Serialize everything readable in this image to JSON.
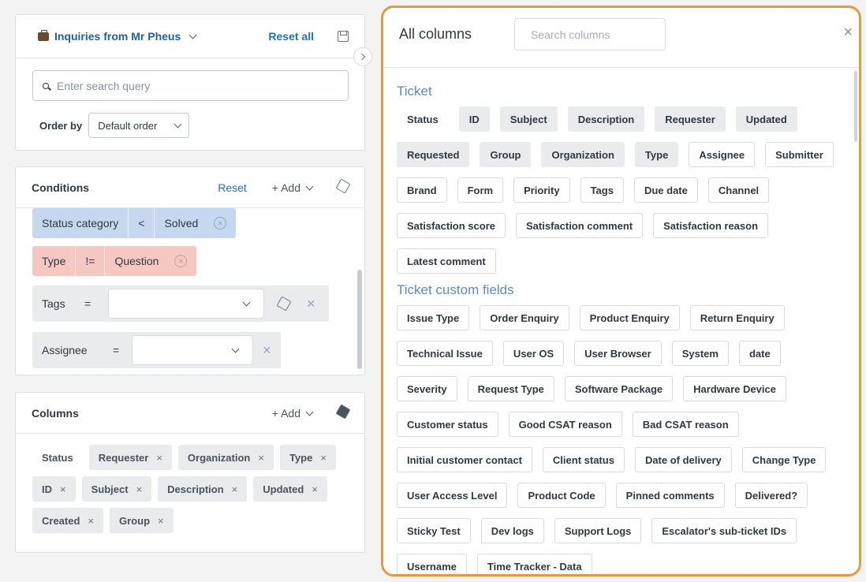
{
  "view": {
    "title": "Inquiries from Mr Pheus",
    "reset_all": "Reset all",
    "search_placeholder": "Enter search query",
    "order_label": "Order by",
    "order_value": "Default order"
  },
  "conditions": {
    "title": "Conditions",
    "reset": "Reset",
    "add": "+ Add",
    "rows": [
      {
        "field": "Status category",
        "op": "<",
        "value": "Solved"
      },
      {
        "field": "Type",
        "op": "!=",
        "value": "Question"
      },
      {
        "field": "Tags",
        "op": "="
      },
      {
        "field": "Assignee",
        "op": "="
      }
    ]
  },
  "columns": {
    "title": "Columns",
    "add": "+ Add",
    "items": [
      "Status",
      "Requester",
      "Organization",
      "Type",
      "ID",
      "Subject",
      "Description",
      "Updated",
      "Created",
      "Group"
    ]
  },
  "dialog": {
    "title": "All columns",
    "search_placeholder": "Search columns",
    "close": "×",
    "sections": [
      {
        "title": "Ticket",
        "chips": [
          {
            "label": "Status",
            "state": "plain"
          },
          {
            "label": "ID",
            "state": "selected"
          },
          {
            "label": "Subject",
            "state": "selected"
          },
          {
            "label": "Description",
            "state": "selected"
          },
          {
            "label": "Requester",
            "state": "selected"
          },
          {
            "label": "Updated",
            "state": "selected"
          },
          {
            "label": "Requested",
            "state": "selected"
          },
          {
            "label": "Group",
            "state": "selected"
          },
          {
            "label": "Organization",
            "state": "selected"
          },
          {
            "label": "Type",
            "state": "selected"
          },
          {
            "label": "Assignee",
            "state": "available"
          },
          {
            "label": "Submitter",
            "state": "available"
          },
          {
            "label": "Brand",
            "state": "available"
          },
          {
            "label": "Form",
            "state": "available"
          },
          {
            "label": "Priority",
            "state": "available"
          },
          {
            "label": "Tags",
            "state": "available"
          },
          {
            "label": "Due date",
            "state": "available"
          },
          {
            "label": "Channel",
            "state": "available"
          },
          {
            "label": "Satisfaction score",
            "state": "available"
          },
          {
            "label": "Satisfaction comment",
            "state": "available"
          },
          {
            "label": "Satisfaction reason",
            "state": "available"
          },
          {
            "label": "Latest comment",
            "state": "available"
          }
        ]
      },
      {
        "title": "Ticket custom fields",
        "chips": [
          {
            "label": "Issue Type",
            "state": "available"
          },
          {
            "label": "Order Enquiry",
            "state": "available"
          },
          {
            "label": "Product Enquiry",
            "state": "available"
          },
          {
            "label": "Return Enquiry",
            "state": "available"
          },
          {
            "label": "Technical Issue",
            "state": "available"
          },
          {
            "label": "User OS",
            "state": "available"
          },
          {
            "label": "User Browser",
            "state": "available"
          },
          {
            "label": "System",
            "state": "available"
          },
          {
            "label": "date",
            "state": "available"
          },
          {
            "label": "Severity",
            "state": "available"
          },
          {
            "label": "Request Type",
            "state": "available"
          },
          {
            "label": "Software Package",
            "state": "available"
          },
          {
            "label": "Hardware Device",
            "state": "available"
          },
          {
            "label": "Customer status",
            "state": "available"
          },
          {
            "label": "Good CSAT reason",
            "state": "available"
          },
          {
            "label": "Bad CSAT reason",
            "state": "available"
          },
          {
            "label": "Initial customer contact",
            "state": "available"
          },
          {
            "label": "Client status",
            "state": "available"
          },
          {
            "label": "Date of delivery",
            "state": "available"
          },
          {
            "label": "Change Type",
            "state": "available"
          },
          {
            "label": "User Access Level",
            "state": "available"
          },
          {
            "label": "Product Code",
            "state": "available"
          },
          {
            "label": "Pinned comments",
            "state": "available"
          },
          {
            "label": "Delivered?",
            "state": "available"
          },
          {
            "label": "Sticky Test",
            "state": "available"
          },
          {
            "label": "Dev logs",
            "state": "available"
          },
          {
            "label": "Support Logs",
            "state": "available"
          },
          {
            "label": "Escalator's sub-ticket IDs",
            "state": "available"
          },
          {
            "label": "Username",
            "state": "available"
          },
          {
            "label": "Time Tracker - Data",
            "state": "available"
          }
        ]
      }
    ]
  },
  "colors": {
    "accent": "#1f73b7",
    "highlight_border": "#e59a3f"
  }
}
